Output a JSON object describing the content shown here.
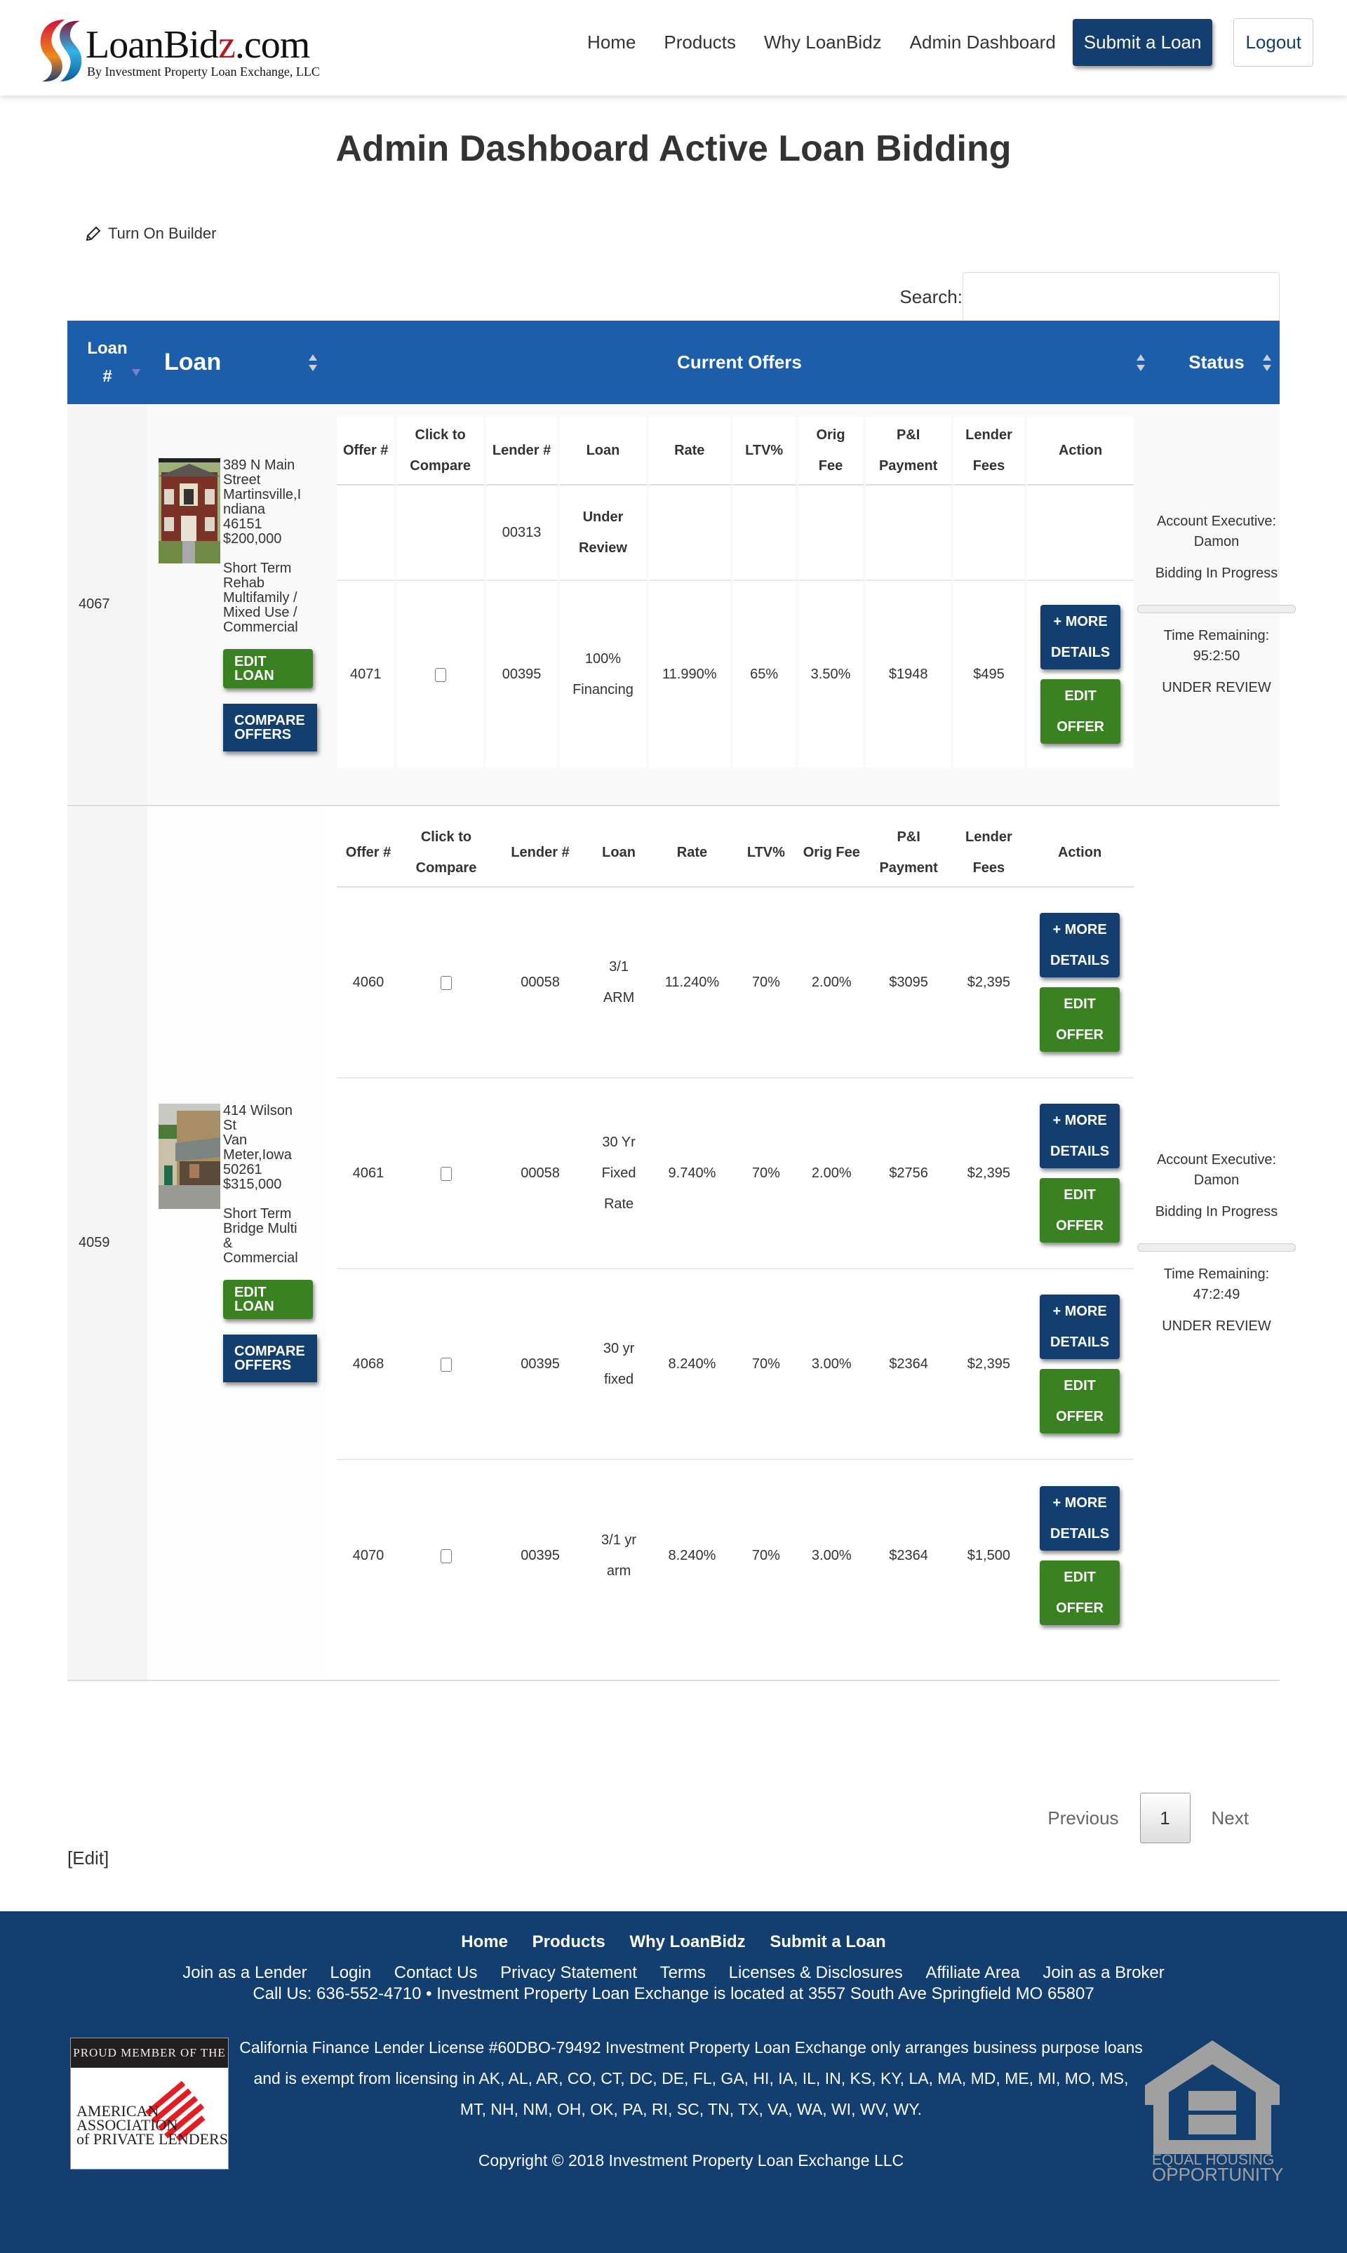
{
  "header": {
    "logo": {
      "word_prefix": "LoanBid",
      "word_accent": "z",
      "word_suffix": ".com",
      "tagline": "By Investment Property Loan Exchange, LLC"
    },
    "nav": [
      {
        "label": "Home"
      },
      {
        "label": "Products"
      },
      {
        "label": "Why LoanBidz"
      },
      {
        "label": "Admin Dashboard"
      }
    ],
    "submit_label": "Submit a Loan",
    "logout_label": "Logout"
  },
  "page_title": "Admin Dashboard Active Loan Bidding",
  "builder_label": "Turn On Builder",
  "search": {
    "label": "Search:",
    "value": "",
    "placeholder": ""
  },
  "table": {
    "headers": {
      "loan_num_line1": "Loan",
      "loan_num_line2": "#",
      "loan": "Loan",
      "offers": "Current Offers",
      "status": "Status"
    },
    "offer_headers_a": [
      "Offer #",
      "Click to Compare",
      "Lender #",
      "Loan",
      "Rate",
      "LTV%",
      "Orig Fee",
      "P&I Payment",
      "Lender Fees",
      "Action"
    ],
    "offer_headers_b": [
      "Offer #",
      "Click to Compare",
      "Lender #",
      "Loan",
      "Rate",
      "LTV%",
      "Orig Fee",
      "P&I Payment",
      "Lender Fees",
      "Action"
    ],
    "more_details_label": "+ MORE DETAILS",
    "edit_offer_label": "EDIT OFFER",
    "edit_loan_label": "EDIT LOAN",
    "compare_offers_label": "COMPARE OFFERS",
    "loans": [
      {
        "loan_number": "4067",
        "address_lines": [
          "389 N Main",
          "Street",
          "Martinsville,I",
          "ndiana",
          "46151",
          "$200,000"
        ],
        "type_lines": [
          "Short Term",
          "Rehab",
          "Multifamily /",
          "Mixed Use /",
          "Commercial"
        ],
        "offers": [
          {
            "offer": "",
            "compare": false,
            "lender": "00313",
            "loan": "Under Review",
            "rate": "",
            "ltv": "",
            "orig_fee": "",
            "pi_payment": "",
            "lender_fees": "",
            "has_actions": false
          },
          {
            "offer": "4071",
            "compare": true,
            "lender": "00395",
            "loan": "100% Financing",
            "rate": "11.990%",
            "ltv": "65%",
            "orig_fee": "3.50%",
            "pi_payment": "$1948",
            "lender_fees": "$495",
            "has_actions": true
          }
        ],
        "status": {
          "account_exec_label": "Account Executive:",
          "account_exec": "Damon",
          "state": "Bidding In Progress",
          "progress": 0,
          "time_label": "Time Remaining:",
          "time_remaining": "95:2:50",
          "review": "UNDER REVIEW"
        }
      },
      {
        "loan_number": "4059",
        "address_lines": [
          "414 Wilson",
          "St",
          "Van",
          "Meter,Iowa",
          "50261",
          "$315,000"
        ],
        "type_lines": [
          "Short Term",
          "Bridge Multi",
          "&",
          "Commercial"
        ],
        "offers": [
          {
            "offer": "4060",
            "compare": true,
            "lender": "00058",
            "loan": "3/1 ARM",
            "rate": "11.240%",
            "ltv": "70%",
            "orig_fee": "2.00%",
            "pi_payment": "$3095",
            "lender_fees": "$2,395",
            "has_actions": true
          },
          {
            "offer": "4061",
            "compare": true,
            "lender": "00058",
            "loan": "30 Yr Fixed Rate",
            "rate": "9.740%",
            "ltv": "70%",
            "orig_fee": "2.00%",
            "pi_payment": "$2756",
            "lender_fees": "$2,395",
            "has_actions": true
          },
          {
            "offer": "4068",
            "compare": true,
            "lender": "00395",
            "loan": "30 yr fixed",
            "rate": "8.240%",
            "ltv": "70%",
            "orig_fee": "3.00%",
            "pi_payment": "$2364",
            "lender_fees": "$2,395",
            "has_actions": true
          },
          {
            "offer": "4070",
            "compare": true,
            "lender": "00395",
            "loan": "3/1 yr arm",
            "rate": "8.240%",
            "ltv": "70%",
            "orig_fee": "3.00%",
            "pi_payment": "$2364",
            "lender_fees": "$1,500",
            "has_actions": true
          }
        ],
        "status": {
          "account_exec_label": "Account Executive:",
          "account_exec": "Damon",
          "state": "Bidding In Progress",
          "progress": 0,
          "time_label": "Time Remaining:",
          "time_remaining": "47:2:49",
          "review": "UNDER REVIEW"
        }
      }
    ]
  },
  "pagination": {
    "previous": "Previous",
    "current": "1",
    "next": "Next"
  },
  "edit_link": "[Edit]",
  "footer": {
    "nav_primary": [
      "Home",
      "Products",
      "Why LoanBidz",
      "Submit a Loan"
    ],
    "nav_secondary": [
      "Join as a Lender",
      "Login",
      "Contact Us",
      "Privacy Statement",
      "Terms",
      "Licenses & Disclosures",
      "Affiliate Area",
      "Join as a Broker"
    ],
    "call_line": "Call Us: 636-552-4710  •  Investment Property Loan Exchange is located at 3557 South Ave Springfield MO 65807",
    "aapl_badge": {
      "top": "PROUD MEMBER OF THE",
      "line1": "AMERICAN",
      "line2": "ASSOCIATION",
      "line3": "of PRIVATE LENDERS"
    },
    "license_text": "California Finance Lender License #60DBO-79492 Investment Property Loan Exchange only arranges business purpose loans and is exempt from licensing in AK, AL, AR, CO, CT, DC, DE, FL, GA, HI, IA, IL, IN, KS, KY, LA, MA, MD, ME, MI, MO, MS, MT, NH, NM, OH, OK, PA, RI, SC, TN, TX, VA, WA, WI, WV, WY.",
    "copyright": "Copyright © 2018 Investment Property Loan Exchange LLC",
    "eho": {
      "line1": "EQUAL HOUSING",
      "line2": "OPPORTUNITY"
    }
  },
  "colors": {
    "brand_navy": "#133e70",
    "table_header_blue": "#1c5ea9",
    "action_green": "#3a8121"
  }
}
